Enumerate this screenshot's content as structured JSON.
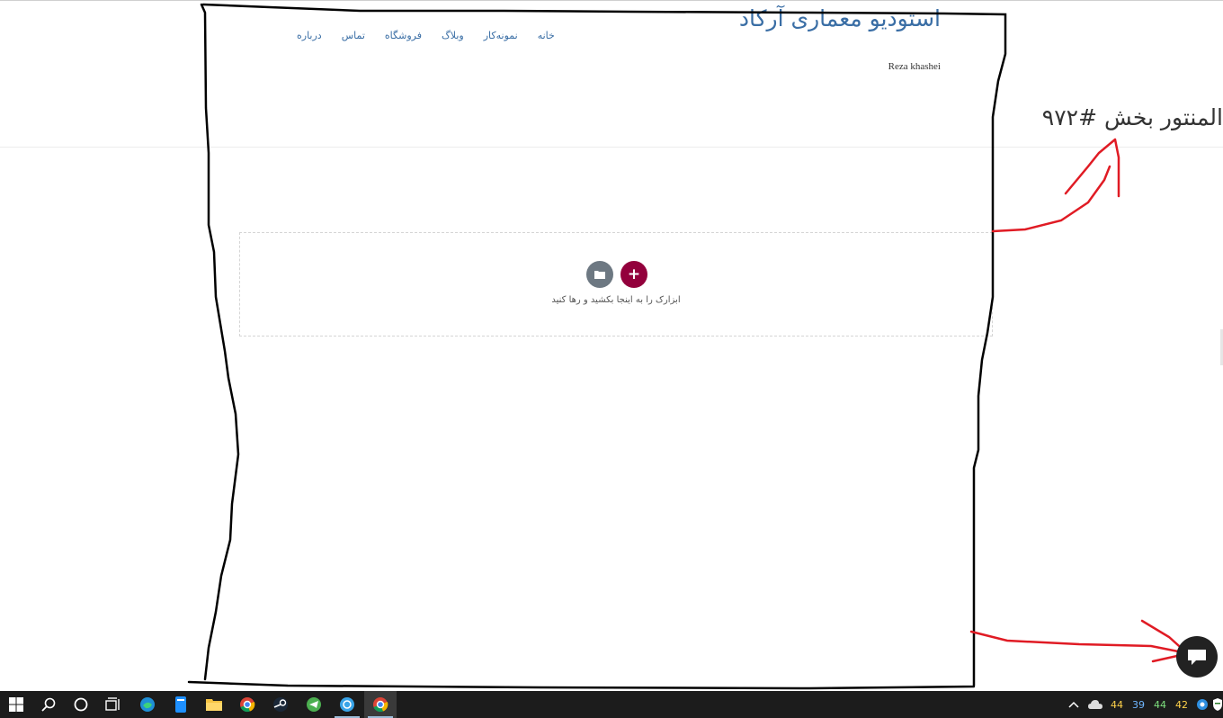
{
  "site": {
    "title": "استودیو معماری آرکاد",
    "tagline": "Reza khashei"
  },
  "nav": {
    "items": [
      "خانه",
      "نمونه‌کار",
      "وبلاگ",
      "فروشگاه",
      "تماس",
      "درباره"
    ]
  },
  "page": {
    "heading": "المنتور بخش #۹۷۲"
  },
  "editor": {
    "drop_hint": "ابزارک را به اینجا بکشید و رها کنید",
    "add_label": "+",
    "accent_color": "#93003c",
    "template_button_color": "#6d7882"
  },
  "taskbar": {
    "icons": [
      "windows-start-icon",
      "search-icon",
      "cortana-icon",
      "task-view-icon",
      "edge-icon",
      "notes-icon",
      "file-explorer-icon",
      "chrome-icon",
      "steam-icon",
      "telegram-icon",
      "vpn-icon",
      "chrome-active-icon"
    ],
    "tray": {
      "chevron": "^",
      "weather": "cloud-icon",
      "temps": [
        "44",
        "39",
        "44",
        "42"
      ],
      "temp_colors": [
        "#ffd24a",
        "#6fb6ff",
        "#7ee07e",
        "#ffd24a"
      ]
    }
  },
  "annotation": {
    "stroke_black": "#000000",
    "stroke_red": "#e01b24"
  }
}
